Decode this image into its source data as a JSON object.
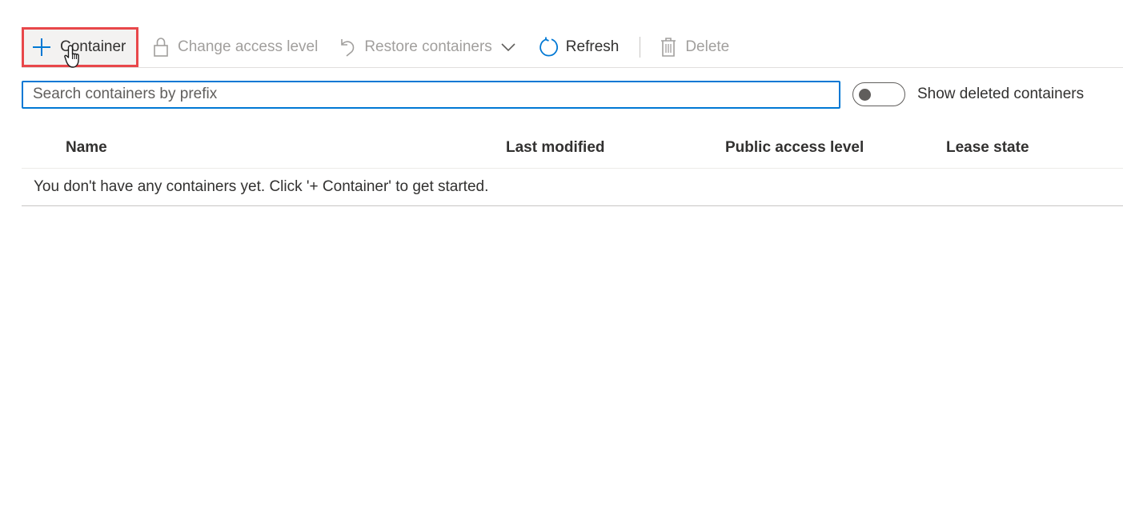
{
  "toolbar": {
    "add_container_label": "Container",
    "change_access_label": "Change access level",
    "restore_label": "Restore containers",
    "refresh_label": "Refresh",
    "delete_label": "Delete"
  },
  "search": {
    "placeholder": "Search containers by prefix",
    "value": ""
  },
  "toggle": {
    "label": "Show deleted containers",
    "state": "off"
  },
  "table": {
    "columns": [
      "Name",
      "Last modified",
      "Public access level",
      "Lease state"
    ],
    "empty_message": "You don't have any containers yet. Click '+ Container' to get started."
  },
  "colors": {
    "accent": "#0078d4",
    "highlight_border": "#e8474a",
    "disabled_text": "#a19f9d"
  },
  "icons": {
    "add": "plus-icon",
    "lock": "lock-icon",
    "undo": "undo-icon",
    "chevron": "chevron-down-icon",
    "refresh": "refresh-icon",
    "delete": "trash-icon",
    "cursor": "hand-cursor-icon"
  }
}
